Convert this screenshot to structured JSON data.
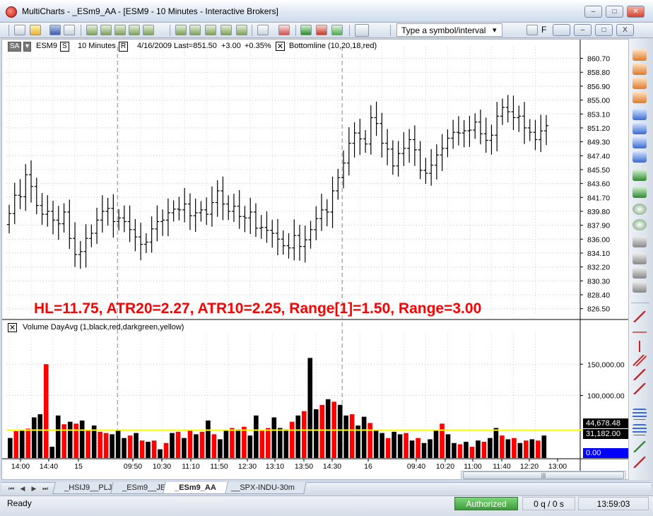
{
  "window": {
    "title": "MultiCharts - _ESm9_AA - [ESM9 - 10 Minutes - Interactive Brokers]",
    "buttons": {
      "minimize": "–",
      "maximize": "□",
      "close": "✕",
      "doc_close": "X"
    }
  },
  "toolbar": {
    "symbol_input_placeholder": "Type a symbol/interval",
    "symbol_dropdown_arrow": "▾",
    "font_label": "F"
  },
  "price_panel": {
    "sa_label": "SA",
    "symbol": "ESM9",
    "s_toggle": "S",
    "interval": "10 Minutes",
    "r_toggle": "R",
    "date": "4/16/2009",
    "last": "Last=851.50",
    "change": "+3.00",
    "change_pct": "+0.35%",
    "indicator": "Bottomline  (10,20,18,red)",
    "annotation": "HL=11.75, ATR20=2.27, ATR10=2.25, Range[1]=1.50, Range=3.00",
    "annotation_color": "#ff0000"
  },
  "volume_panel": {
    "indicator": "Volume DayAvg  (1,black,red,darkgreen,yellow)",
    "marker_values": [
      "44,678.48",
      "31,182.00",
      "0.00"
    ]
  },
  "chart_data": [
    {
      "type": "ohlc",
      "symbol": "ESM9",
      "interval": "10 Minutes",
      "y_ticks": [
        860.7,
        858.8,
        856.9,
        855.0,
        853.1,
        851.2,
        849.3,
        847.4,
        845.5,
        843.6,
        841.7,
        839.8,
        837.9,
        836.0,
        834.1,
        832.2,
        830.3,
        828.4,
        826.5
      ],
      "ylim": [
        825.6,
        862.3
      ],
      "bar_color": "#000000",
      "closes": [
        839.5,
        842.0,
        841.8,
        844.8,
        843.2,
        840.6,
        839.4,
        839.8,
        838.6,
        838.1,
        839.7,
        836.1,
        833.9,
        834.3,
        836.1,
        836.8,
        838.6,
        839.8,
        840.2,
        838.4,
        838.9,
        838.4,
        837.3,
        836.3,
        835.3,
        835.6,
        837.4,
        838.4,
        838.6,
        839.6,
        840.1,
        840.0,
        840.8,
        839.2,
        839.6,
        840.0,
        839.4,
        841.0,
        842.6,
        840.8,
        839.8,
        840.5,
        839.1,
        838.9,
        839.7,
        837.5,
        837.6,
        837.2,
        836.8,
        836.0,
        835.1,
        834.8,
        836.5,
        835.0,
        835.9,
        837.3,
        838.8,
        840.0,
        839.7,
        842.6,
        844.4,
        846.4,
        849.1,
        850.5,
        849.7,
        849.0,
        852.6,
        851.8,
        849.1,
        848.3,
        846.0,
        847.7,
        848.4,
        849.6,
        848.2,
        845.4,
        845.0,
        846.1,
        847.5,
        848.4,
        849.8,
        850.6,
        850.5,
        850.8,
        850.9,
        852.0,
        850.4,
        849.5,
        850.2,
        852.8,
        854.0,
        853.4,
        852.6,
        852.8,
        851.2,
        850.6,
        849.6,
        850.8,
        851.5
      ],
      "x_tick_labels": [
        "14:00",
        "14:40",
        "15",
        "09:50",
        "10:30",
        "11:10",
        "11:50",
        "12:30",
        "13:10",
        "13:50",
        "14:30",
        "16",
        "09:40",
        "10:20",
        "11:00",
        "11:40",
        "12:20",
        "13:00"
      ],
      "session_breaks": [
        "15",
        "16"
      ]
    },
    {
      "type": "bar",
      "title": "Volume DayAvg",
      "y_ticks": [
        150000,
        100000
      ],
      "ylim": [
        0,
        200000
      ],
      "average_line_value": 44678.48,
      "average_line_color": "#ffff00",
      "colors": {
        "up": "#ff0000",
        "down": "#000000"
      },
      "values": [
        32000,
        43000,
        45000,
        47000,
        65000,
        70000,
        150000,
        18000,
        68000,
        54000,
        58000,
        55000,
        60000,
        44000,
        52000,
        42000,
        40000,
        38000,
        45000,
        32000,
        36000,
        40000,
        28000,
        26000,
        28000,
        14000,
        24000,
        40000,
        42000,
        32000,
        44000,
        38000,
        42000,
        60000,
        38000,
        30000,
        45000,
        48000,
        46000,
        50000,
        36000,
        68000,
        45000,
        48000,
        65000,
        48000,
        46000,
        58000,
        68000,
        75000,
        160000,
        78000,
        85000,
        94000,
        90000,
        85000,
        68000,
        70000,
        52000,
        66000,
        56000,
        44000,
        40000,
        32000,
        42000,
        38000,
        40000,
        28000,
        32000,
        24000,
        30000,
        45000,
        55000,
        38000,
        24000,
        22000,
        26000,
        18000,
        28000,
        26000,
        32000,
        48000,
        36000,
        30000,
        32000,
        24000,
        28000,
        30000,
        28000,
        36000
      ],
      "up": [
        false,
        true,
        false,
        true,
        false,
        false,
        true,
        false,
        false,
        true,
        false,
        true,
        false,
        true,
        false,
        true,
        true,
        false,
        false,
        false,
        true,
        false,
        true,
        false,
        true,
        false,
        true,
        false,
        true,
        false,
        true,
        false,
        true,
        false,
        true,
        false,
        false,
        true,
        false,
        true,
        false,
        false,
        true,
        true,
        false,
        false,
        false,
        true,
        false,
        true,
        false,
        false,
        true,
        false,
        true,
        false,
        false,
        true,
        false,
        false,
        true,
        false,
        false,
        true,
        false,
        false,
        true,
        false,
        true,
        false,
        false,
        false,
        true,
        false,
        false,
        true,
        false,
        true,
        false,
        true,
        false,
        false,
        true,
        false,
        true,
        false,
        true,
        false,
        true,
        false
      ]
    }
  ],
  "tabs": [
    "_HSIJ9__PLJd",
    "_ESm9__JE",
    "_ESm9_AA",
    "__SPX-INDU-30m"
  ],
  "active_tab": "_ESm9_AA",
  "tab_nav": {
    "first": "⏮",
    "prev": "◀",
    "next": "▶",
    "last": "⏭"
  },
  "status": {
    "ready": "Ready",
    "connection": "Authorized",
    "connection_color": "#3c9c38",
    "queue": "0 q / 0 s",
    "time": "13:59:03"
  },
  "icons": {
    "toolbar": [
      "new-doc-icon",
      "open-folder-icon",
      "save-icon",
      "print-icon",
      "chart-icon",
      "indicator-icon",
      "signal-icon",
      "drawing-icon",
      "pointer-icon"
    ],
    "rightbar": [
      "scroll-up-icon",
      "scroll-down-icon",
      "hourglass-icon",
      "zoom-in-icon",
      "zoom-out-icon",
      "trendline-icon",
      "hline-icon",
      "fib-icon"
    ]
  }
}
